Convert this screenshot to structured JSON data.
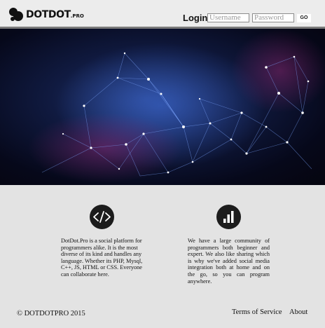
{
  "header": {
    "logo_text": "DOTDOT",
    "logo_suffix": ".PRO",
    "login_label": "Login:",
    "username_placeholder": "Username",
    "password_placeholder": "Password",
    "go_label": "GO"
  },
  "features": [
    {
      "icon": "code-icon",
      "text": "DotDot.Pro is a social platform for programmers alike. It is the most diverse of its kind and handles any language. Whether its PHP, Mysql, C++, JS, HTML or CSS. Everyone can collaborate here."
    },
    {
      "icon": "bar-chart-icon",
      "text": "We have a large community of programmers both beginner and expert. We also like sharing which is why we've added social media integration both at home and on the go, so you can program anywhere."
    }
  ],
  "footer": {
    "copyright": "© DOTDOTPRO 2015",
    "links": [
      "Terms of Service",
      "About"
    ]
  }
}
